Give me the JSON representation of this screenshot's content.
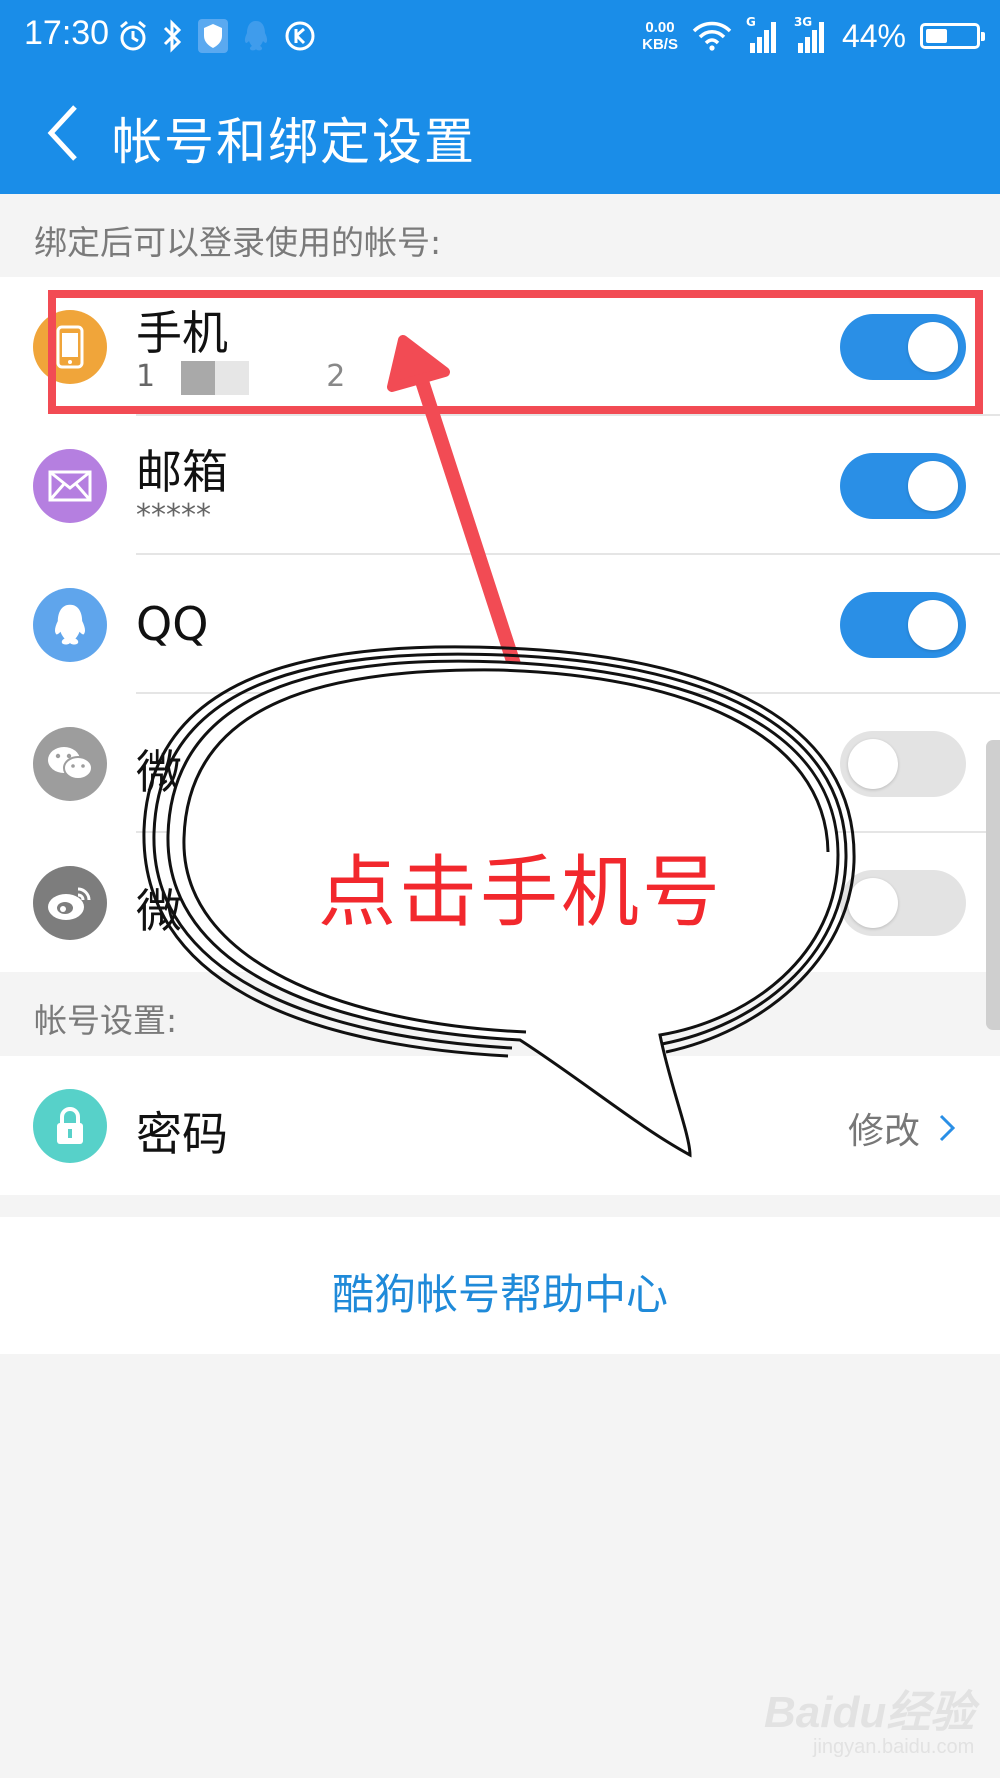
{
  "status_bar": {
    "time": "17:30",
    "net_speed_value": "0.00",
    "net_speed_unit": "KB/S",
    "signal_1_label": "G",
    "signal_2_label": "3G",
    "battery_text": "44%",
    "battery_level": 0.44,
    "icons": [
      "alarm-icon",
      "bluetooth-icon",
      "shield-icon",
      "qq-icon",
      "kugou-icon",
      "wifi-icon",
      "signal-icon",
      "battery-icon"
    ]
  },
  "header": {
    "title": "帐号和绑定设置"
  },
  "section_bind": {
    "label": "绑定后可以登录使用的帐号:",
    "items": [
      {
        "title": "手机",
        "sub": "1",
        "sub_tail": "2",
        "enabled": true,
        "icon": "phone-icon",
        "icon_color": "#f0a53a"
      },
      {
        "title": "邮箱",
        "sub": "*****",
        "enabled": true,
        "icon": "mail-icon",
        "icon_color": "#b57fe0"
      },
      {
        "title": "QQ",
        "enabled": true,
        "icon": "qq-icon",
        "icon_color": "#5fa5ec"
      },
      {
        "title": "微信",
        "enabled": false,
        "icon": "wechat-icon",
        "icon_color": "#9d9d9d"
      },
      {
        "title": "微",
        "enabled": false,
        "icon": "weibo-icon",
        "icon_color": "#7d7d7d"
      }
    ]
  },
  "section_account": {
    "label": "帐号设置:",
    "password": {
      "title": "密码",
      "action": "修改",
      "icon": "lock-icon",
      "icon_color": "#57d1c9"
    }
  },
  "help": {
    "label": "酷狗帐号帮助中心"
  },
  "annotation": {
    "callout_text": "点击手机号",
    "color": "#f24b54"
  },
  "watermark": {
    "logo": "Baidu经验",
    "site": "jingyan.baidu.com"
  },
  "colors": {
    "primary": "#1a8de8",
    "toggle_on": "#2a8fe6",
    "toggle_off": "#e3e3e3"
  }
}
